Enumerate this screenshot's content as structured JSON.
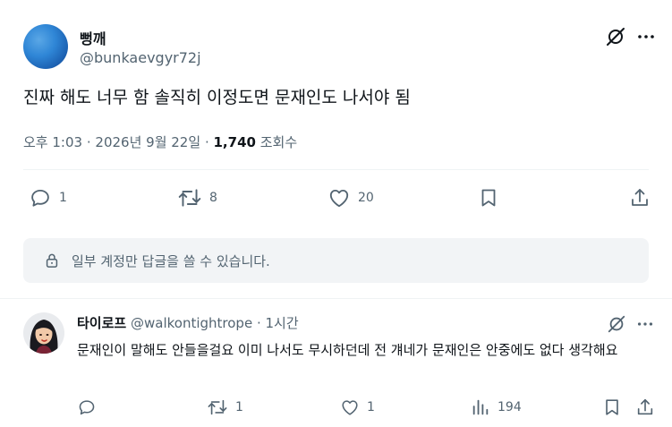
{
  "post": {
    "author_name": "뻥깨",
    "author_handle": "@bunkaevgyr72j",
    "text": "진짜 해도 너무 함 솔직히 이정도면 문재인도 나서야 됨",
    "time": "오후 1:03",
    "date": "2026년 9월 22일",
    "views_count": "1,740",
    "views_label": "조회수",
    "dot": "·",
    "stats": {
      "replies": "1",
      "reposts": "8",
      "likes": "20"
    },
    "reply_restriction": "일부 계정만 답글을 쓸 수 있습니다."
  },
  "reply": {
    "author_name": "타이로프",
    "author_handle": "@walkontightrope",
    "time": "1시간",
    "dot": "·",
    "text": "문재인이 말해도 안들을걸요 이미 나서도 무시하던데 전 걔네가 문재인은 안중에도 없다 생각해요",
    "stats": {
      "replies": "",
      "reposts": "1",
      "likes": "1",
      "views": "194"
    }
  },
  "icons": {
    "grok": "grok-icon",
    "more": "more-icon",
    "reply": "reply-icon",
    "repost": "repost-icon",
    "like": "heart-icon",
    "bookmark": "bookmark-icon",
    "share": "share-icon",
    "views": "views-icon",
    "lock": "lock-icon"
  },
  "colors": {
    "text": "#0f1419",
    "muted": "#536471",
    "divider": "#eff3f4",
    "notice_bg": "#f2f4f6"
  }
}
